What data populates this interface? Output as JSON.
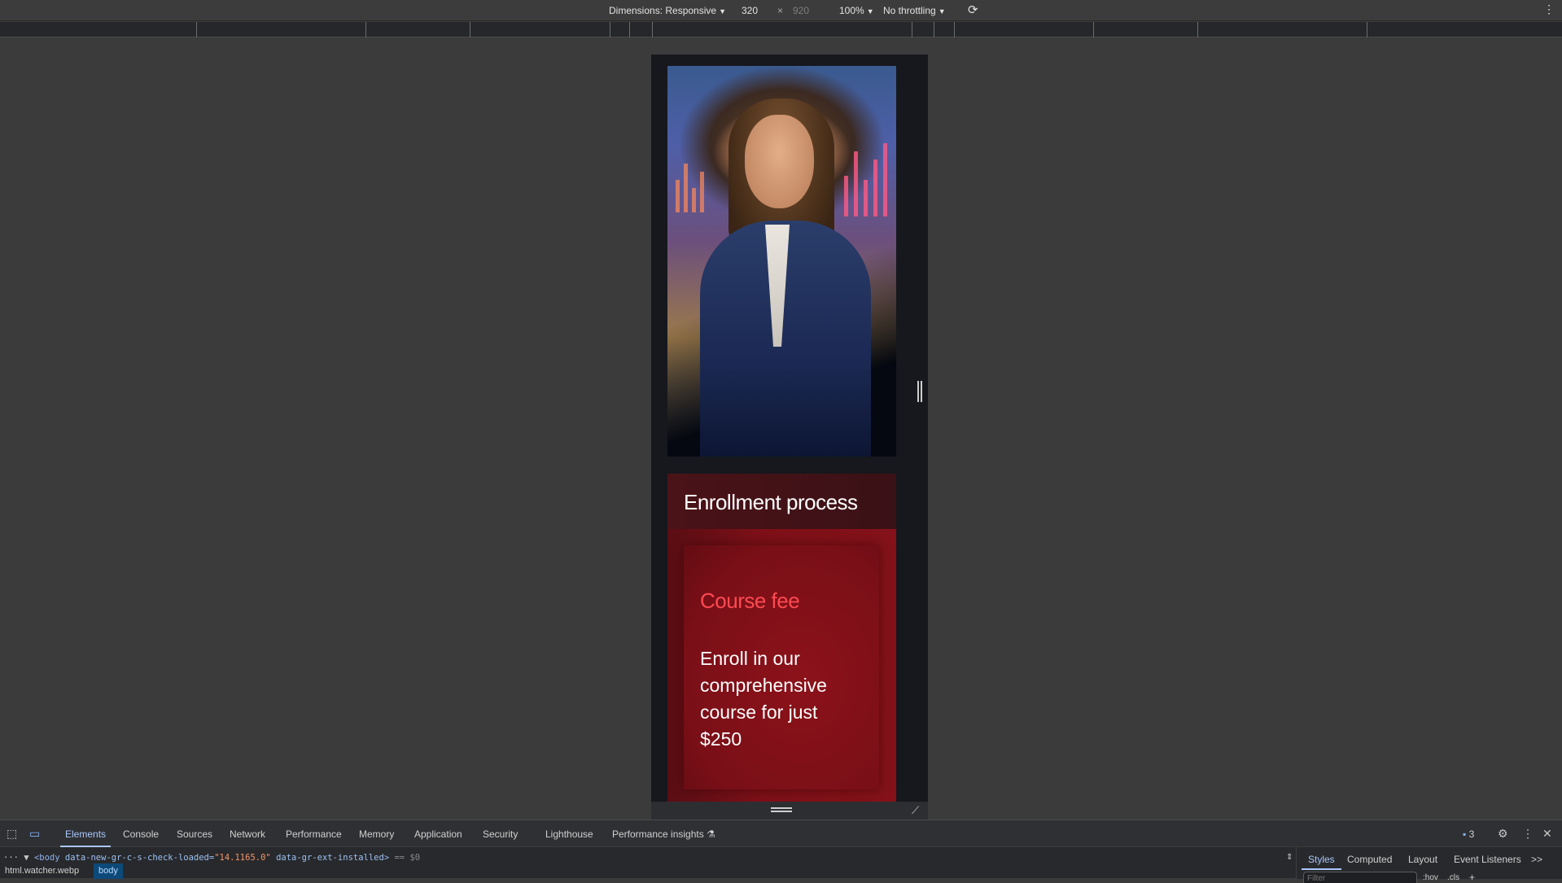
{
  "toolbar": {
    "dimensions_label": "Dimensions: Responsive",
    "width_value": "320",
    "times": "×",
    "height_value": "920",
    "zoom": "100%",
    "throttling": "No throttling",
    "rotate_icon": "rotate-icon",
    "more_icon": "more-vertical-icon"
  },
  "page": {
    "hero_alt": "Smiling businesswoman in a navy suit in front of financial charts",
    "section_title": "Enrollment process",
    "card_title": "Course fee",
    "card_text": "Enroll in our comprehensive course for just $250"
  },
  "colors": {
    "card_title": "#ff4a52",
    "card_bg": "#85121a",
    "header_bg": "#4a1318",
    "active_tab": "#a8c7fa"
  },
  "devtools": {
    "tabs": [
      "Elements",
      "Console",
      "Sources",
      "Network",
      "Performance",
      "Memory",
      "Application",
      "Security",
      "Lighthouse",
      "Performance insights"
    ],
    "active_tab": "Elements",
    "issues_count": "3",
    "dom_line": {
      "prefix": "··· ▼",
      "tag_open": "<body",
      "attr1": " data-new-gr-c-s-check-loaded=",
      "attr1_value": "\"14.1165.0\"",
      "attr2": " data-gr-ext-installed",
      "tag_close": ">",
      "ref": " == $0"
    },
    "breadcrumbs": [
      "html.watcher.webp",
      "body"
    ],
    "side_tabs": [
      "Styles",
      "Computed",
      "Layout",
      "Event Listeners",
      ">>"
    ],
    "filter_placeholder": "Filter",
    "style_tools": [
      ":hov",
      ".cls",
      "+"
    ]
  }
}
